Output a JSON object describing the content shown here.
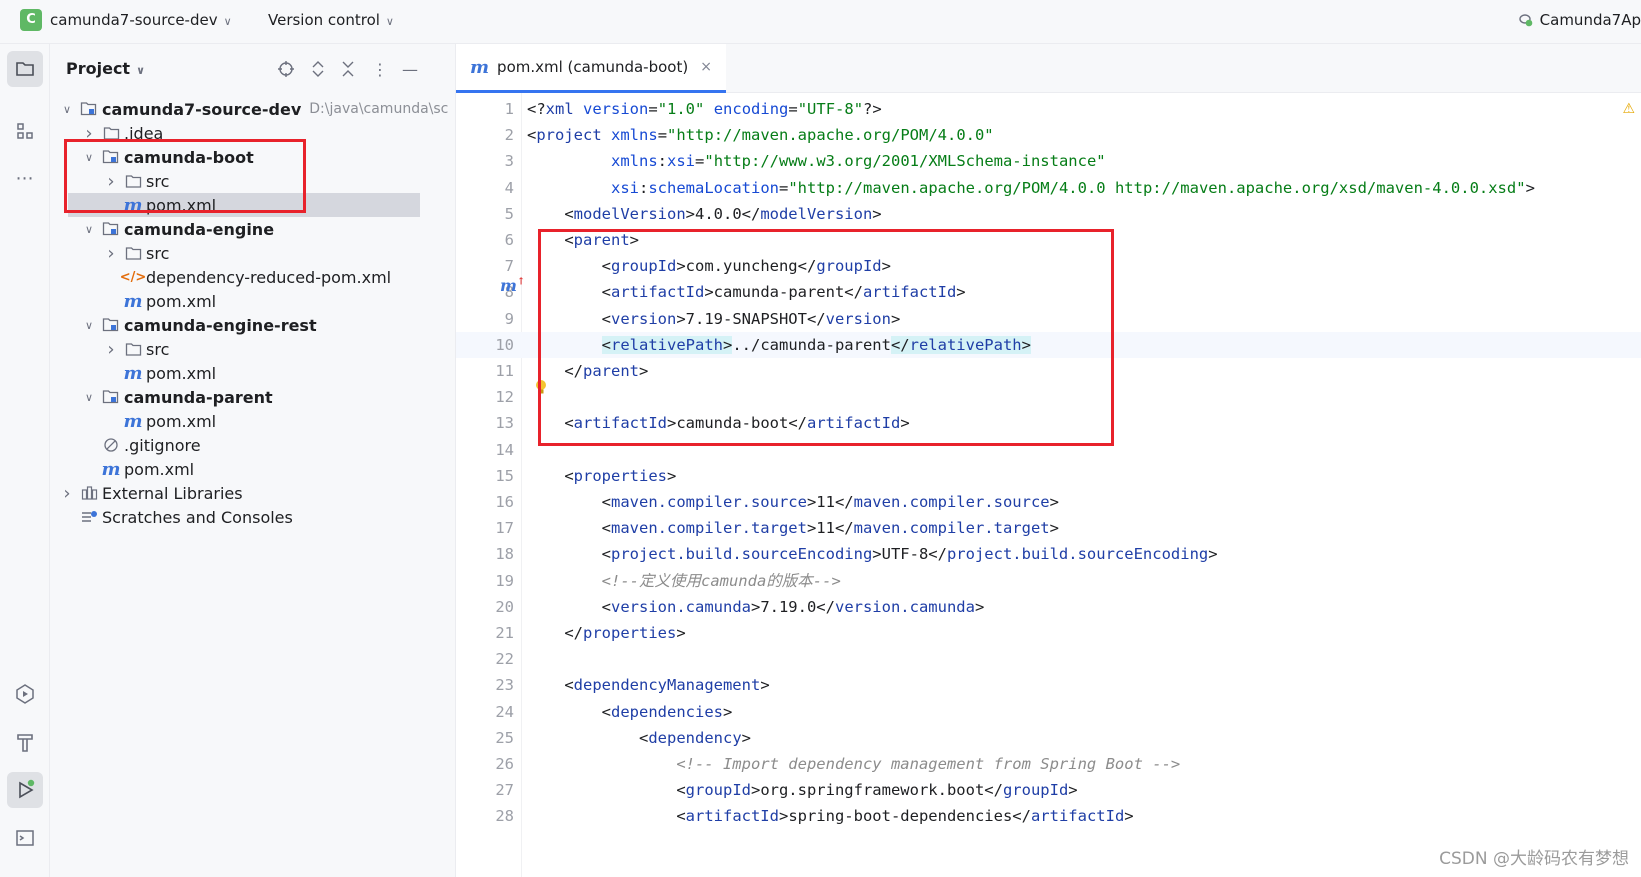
{
  "titlebar": {
    "project_badge": "C",
    "project_name": "camunda7-source-dev",
    "version_control": "Version control",
    "run_config": "Camunda7Ap"
  },
  "project_panel": {
    "title": "Project",
    "tree": [
      {
        "label": "camunda7-source-dev",
        "path": "D:\\java\\camunda\\sc",
        "bold": true,
        "arrow": "down",
        "icon": "module-folder-icon",
        "indent": 0
      },
      {
        "label": ".idea",
        "bold": false,
        "arrow": "right",
        "icon": "folder-icon",
        "indent": 1
      },
      {
        "label": "camunda-boot",
        "bold": true,
        "arrow": "down",
        "icon": "module-folder-icon",
        "indent": 1
      },
      {
        "label": "src",
        "bold": false,
        "arrow": "right",
        "icon": "folder-icon",
        "indent": 2
      },
      {
        "label": "pom.xml",
        "bold": false,
        "arrow": "none",
        "icon": "maven-icon",
        "indent": 2,
        "selected": true
      },
      {
        "label": "camunda-engine",
        "bold": true,
        "arrow": "down",
        "icon": "module-folder-icon",
        "indent": 1
      },
      {
        "label": "src",
        "bold": false,
        "arrow": "right",
        "icon": "folder-icon",
        "indent": 2
      },
      {
        "label": "dependency-reduced-pom.xml",
        "bold": false,
        "arrow": "none",
        "icon": "xml-icon",
        "indent": 2
      },
      {
        "label": "pom.xml",
        "bold": false,
        "arrow": "none",
        "icon": "maven-icon",
        "indent": 2
      },
      {
        "label": "camunda-engine-rest",
        "bold": true,
        "arrow": "down",
        "icon": "module-folder-icon",
        "indent": 1
      },
      {
        "label": "src",
        "bold": false,
        "arrow": "right",
        "icon": "folder-icon",
        "indent": 2
      },
      {
        "label": "pom.xml",
        "bold": false,
        "arrow": "none",
        "icon": "maven-icon",
        "indent": 2
      },
      {
        "label": "camunda-parent",
        "bold": true,
        "arrow": "down",
        "icon": "module-folder-icon",
        "indent": 1
      },
      {
        "label": "pom.xml",
        "bold": false,
        "arrow": "none",
        "icon": "maven-icon",
        "indent": 2
      },
      {
        "label": ".gitignore",
        "bold": false,
        "arrow": "none",
        "icon": "ignore-icon",
        "indent": 1
      },
      {
        "label": "pom.xml",
        "bold": false,
        "arrow": "none",
        "icon": "maven-icon",
        "indent": 1
      },
      {
        "label": "External Libraries",
        "bold": false,
        "arrow": "right",
        "icon": "library-icon",
        "indent": 0
      },
      {
        "label": "Scratches and Consoles",
        "bold": false,
        "arrow": "none",
        "icon": "scratches-icon",
        "indent": 0
      }
    ]
  },
  "editor": {
    "tab_label": "pom.xml (camunda-boot)",
    "tab_close": "×",
    "lines": [
      {
        "n": "1",
        "html": "<span class=\"p\">&lt;?</span><span class=\"t\">xml</span> <span class=\"a\">version</span><span class=\"p\">=</span><span class=\"v\">\"1.0\"</span> <span class=\"a\">encoding</span><span class=\"p\">=</span><span class=\"v\">\"UTF-8\"</span><span class=\"p\">?&gt;</span>",
        "indent": 0
      },
      {
        "n": "2",
        "html": "<span class=\"p\">&lt;</span><span class=\"t\">project</span> <span class=\"a\">xmlns</span><span class=\"p\">=</span><span class=\"v\">\"http://maven.apache.org/POM/4.0.0\"</span>",
        "indent": 0
      },
      {
        "n": "3",
        "html": "         <span class=\"a\">xmlns</span><span class=\"p\">:</span><span class=\"a\">xsi</span><span class=\"p\">=</span><span class=\"v\">\"http://www.w3.org/2001/XMLSchema-instance\"</span>",
        "indent": 0
      },
      {
        "n": "4",
        "html": "         <span class=\"a\">xsi</span><span class=\"p\">:</span><span class=\"a\">schemaLocation</span><span class=\"p\">=</span><span class=\"v\">\"http://maven.apache.org/POM/4.0.0 http://maven.apache.org/xsd/maven-4.0.0.xsd\"</span><span class=\"p\">&gt;</span>",
        "indent": 0
      },
      {
        "n": "5",
        "html": "    <span class=\"p\">&lt;</span><span class=\"t\">modelVersion</span><span class=\"p\">&gt;4.0.0&lt;/</span><span class=\"t\">modelVersion</span><span class=\"p\">&gt;</span>",
        "indent": 0
      },
      {
        "n": "6",
        "html": "    <span class=\"p\">&lt;</span><span class=\"t\">parent</span><span class=\"p\">&gt;</span>",
        "indent": 0
      },
      {
        "n": "7",
        "html": "        <span class=\"p\">&lt;</span><span class=\"t\">groupId</span><span class=\"p\">&gt;com.yuncheng&lt;/</span><span class=\"t\">groupId</span><span class=\"p\">&gt;</span>",
        "indent": 0
      },
      {
        "n": "8",
        "html": "        <span class=\"p\">&lt;</span><span class=\"t\">artifactId</span><span class=\"p\">&gt;camunda-parent&lt;/</span><span class=\"t\">artifactId</span><span class=\"p\">&gt;</span>",
        "indent": 0
      },
      {
        "n": "9",
        "html": "        <span class=\"p\">&lt;</span><span class=\"t\">version</span><span class=\"p\">&gt;7.19-SNAPSHOT&lt;/</span><span class=\"t\">version</span><span class=\"p\">&gt;</span>",
        "indent": 0
      },
      {
        "n": "10",
        "html": "        <span class=\"rp\"><span class=\"p\">&lt;</span><span class=\"t\">relativePath</span><span class=\"p\">&gt;</span></span><span class=\"p\">../camunda-parent</span><span class=\"rp\"><span class=\"p\">&lt;/</span><span class=\"t\">relativePath</span><span class=\"p\">&gt;</span></span>",
        "indent": 0,
        "highlight": true
      },
      {
        "n": "11",
        "html": "    <span class=\"p\">&lt;/</span><span class=\"t\">parent</span><span class=\"p\">&gt;</span>",
        "indent": 0
      },
      {
        "n": "12",
        "html": "",
        "indent": 0
      },
      {
        "n": "13",
        "html": "    <span class=\"p\">&lt;</span><span class=\"t\">artifactId</span><span class=\"p\">&gt;camunda-boot&lt;/</span><span class=\"t\">artifactId</span><span class=\"p\">&gt;</span>",
        "indent": 0
      },
      {
        "n": "14",
        "html": "",
        "indent": 0
      },
      {
        "n": "15",
        "html": "    <span class=\"p\">&lt;</span><span class=\"t\">properties</span><span class=\"p\">&gt;</span>",
        "indent": 0
      },
      {
        "n": "16",
        "html": "        <span class=\"p\">&lt;</span><span class=\"t\">maven.compiler.source</span><span class=\"p\">&gt;11&lt;/</span><span class=\"t\">maven.compiler.source</span><span class=\"p\">&gt;</span>",
        "indent": 0
      },
      {
        "n": "17",
        "html": "        <span class=\"p\">&lt;</span><span class=\"t\">maven.compiler.target</span><span class=\"p\">&gt;11&lt;/</span><span class=\"t\">maven.compiler.target</span><span class=\"p\">&gt;</span>",
        "indent": 0
      },
      {
        "n": "18",
        "html": "        <span class=\"p\">&lt;</span><span class=\"t\">project.build.sourceEncoding</span><span class=\"p\">&gt;UTF-8&lt;/</span><span class=\"t\">project.build.sourceEncoding</span><span class=\"p\">&gt;</span>",
        "indent": 0
      },
      {
        "n": "19",
        "html": "        <span class=\"c\">&lt;!--定义使用camunda的版本--&gt;</span>",
        "indent": 0
      },
      {
        "n": "20",
        "html": "        <span class=\"p\">&lt;</span><span class=\"t\">version.camunda</span><span class=\"p\">&gt;7.19.0&lt;/</span><span class=\"t\">version.camunda</span><span class=\"p\">&gt;</span>",
        "indent": 0
      },
      {
        "n": "21",
        "html": "    <span class=\"p\">&lt;/</span><span class=\"t\">properties</span><span class=\"p\">&gt;</span>",
        "indent": 0
      },
      {
        "n": "22",
        "html": "",
        "indent": 0
      },
      {
        "n": "23",
        "html": "    <span class=\"p\">&lt;</span><span class=\"t\">dependencyManagement</span><span class=\"p\">&gt;</span>",
        "indent": 0
      },
      {
        "n": "24",
        "html": "        <span class=\"p\">&lt;</span><span class=\"t\">dependencies</span><span class=\"p\">&gt;</span>",
        "indent": 0
      },
      {
        "n": "25",
        "html": "            <span class=\"p\">&lt;</span><span class=\"t\">dependency</span><span class=\"p\">&gt;</span>",
        "indent": 0
      },
      {
        "n": "26",
        "html": "                <span class=\"c\">&lt;!-- Import dependency management from Spring Boot --&gt;</span>",
        "indent": 0
      },
      {
        "n": "27",
        "html": "                <span class=\"p\">&lt;</span><span class=\"t\">groupId</span><span class=\"p\">&gt;org.springframework.boot&lt;/</span><span class=\"t\">groupId</span><span class=\"p\">&gt;</span>",
        "indent": 0
      },
      {
        "n": "28",
        "html": "                <span class=\"p\">&lt;</span><span class=\"t\">artifactId</span><span class=\"p\">&gt;spring-boot-dependencies&lt;/</span><span class=\"t\">artifactId</span><span class=\"p\">&gt;</span>",
        "indent": 0
      }
    ]
  },
  "watermark": "CSDN @大龄码农有梦想",
  "colors": {
    "accent": "#3574f0",
    "annotation_red": "#e8222b",
    "tag": "#1f3ea6",
    "string": "#067d17"
  }
}
